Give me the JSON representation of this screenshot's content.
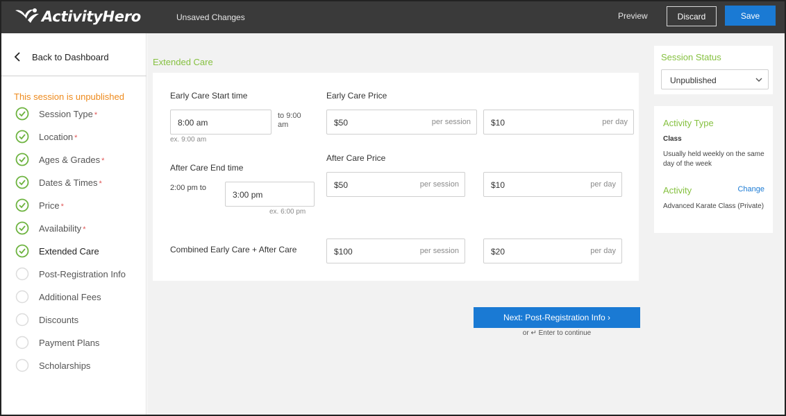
{
  "app": {
    "logo_text": "ActivityHero",
    "unsaved": "Unsaved Changes"
  },
  "header": {
    "preview": "Preview",
    "discard": "Discard",
    "save": "Save"
  },
  "sidebar": {
    "back": "Back to Dashboard",
    "unpublished_notice": "This session is unpublished",
    "items": [
      {
        "label": "Session Type",
        "required": "*",
        "done": true
      },
      {
        "label": "Location",
        "required": "*",
        "done": true
      },
      {
        "label": "Ages & Grades",
        "required": "*",
        "done": true
      },
      {
        "label": "Dates & Times",
        "required": "*",
        "done": true
      },
      {
        "label": "Price",
        "required": "*",
        "done": true
      },
      {
        "label": "Availability",
        "required": "*",
        "done": true
      },
      {
        "label": "Extended Care",
        "required": "",
        "done": true
      },
      {
        "label": "Post-Registration Info",
        "required": "",
        "done": false
      },
      {
        "label": "Additional Fees",
        "required": "",
        "done": false
      },
      {
        "label": "Discounts",
        "required": "",
        "done": false
      },
      {
        "label": "Payment Plans",
        "required": "",
        "done": false
      },
      {
        "label": "Scholarships",
        "required": "",
        "done": false
      }
    ]
  },
  "form": {
    "section_title": "Extended Care",
    "early_start_label": "Early Care Start time",
    "early_start_value": "8:00 am",
    "early_start_to": "to 9:00 am",
    "early_start_hint": "ex. 9:00 am",
    "early_price_label": "Early Care Price",
    "early_price_session": "$50",
    "early_price_day": "$10",
    "after_end_label": "After Care End time",
    "after_end_from": "2:00 pm to",
    "after_end_value": "3:00 pm",
    "after_end_hint": "ex. 6:00 pm",
    "after_price_label": "After Care Price",
    "after_price_session": "$50",
    "after_price_day": "$10",
    "combined_label": "Combined Early Care + After Care",
    "combined_session": "$100",
    "combined_day": "$20",
    "per_session": "per session",
    "per_day": "per day",
    "next_button": "Next: Post-Registration Info ›",
    "enter_hint": "or ↵ Enter to continue"
  },
  "status": {
    "title": "Session Status",
    "value": "Unpublished"
  },
  "activity": {
    "type_title": "Activity Type",
    "type_value": "Class",
    "type_desc": "Usually held weekly on the same day of the week",
    "activity_title": "Activity",
    "change": "Change",
    "activity_name": "Advanced Karate Class (Private)"
  },
  "colors": {
    "accent_green": "#86c141",
    "primary_blue": "#1a7ad4",
    "warning_orange": "#ee8a1c",
    "topbar": "#3a3a3a"
  }
}
